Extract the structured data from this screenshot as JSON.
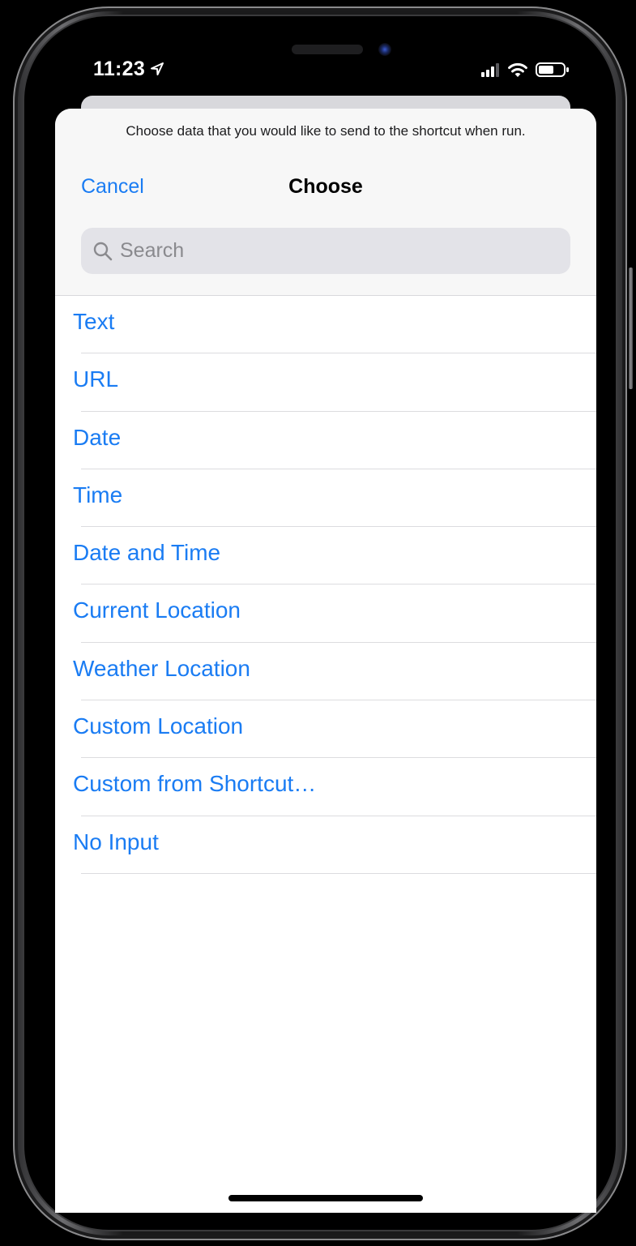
{
  "status_bar": {
    "time": "11:23",
    "location_icon": "location-arrow-icon",
    "signal_icon": "cellular-signal-icon",
    "wifi_icon": "wifi-icon",
    "battery_icon": "battery-icon"
  },
  "sheet": {
    "prompt": "Choose data that you would like to send to the shortcut when run.",
    "cancel_label": "Cancel",
    "title": "Choose",
    "search": {
      "placeholder": "Search",
      "value": "",
      "icon": "search-icon"
    },
    "options": [
      {
        "label": "Text"
      },
      {
        "label": "URL"
      },
      {
        "label": "Date"
      },
      {
        "label": "Time"
      },
      {
        "label": "Date and Time"
      },
      {
        "label": "Current Location"
      },
      {
        "label": "Weather Location"
      },
      {
        "label": "Custom Location"
      },
      {
        "label": "Custom from Shortcut…"
      },
      {
        "label": "No Input"
      }
    ]
  },
  "colors": {
    "accent": "#1a7cf3",
    "header_background": "#f7f7f7",
    "search_background": "#e3e3e8",
    "separator": "#dcdcdf"
  }
}
